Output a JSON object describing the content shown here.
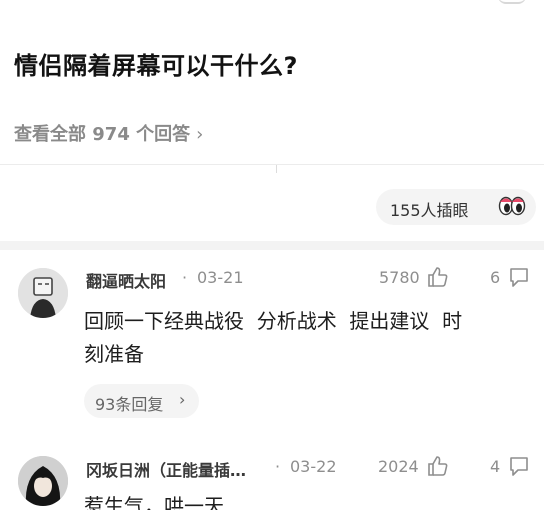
{
  "question": {
    "title": "情侣隔着屏幕可以干什么?",
    "view_all_label": "查看全部 974 个回答",
    "chevron": "›"
  },
  "reactions": {
    "count_label": "155人插眼",
    "emoji_icon": "eyes-icon"
  },
  "answers": [
    {
      "author": "翻逼晒太阳",
      "date_sep": "·",
      "date": "03-21",
      "likes": "5780",
      "comments": "6",
      "text_line1": "回顾一下经典战役  分析战术  提出建议  时",
      "text_line2": "刻准备",
      "replies_label": "93条回复",
      "replies_chevron": "›"
    },
    {
      "author": "冈坂日洲（正能量插…",
      "date_sep": "·",
      "date": "03-22",
      "likes": "2024",
      "comments": "4",
      "text_line1": "惹生气，哄一天"
    }
  ],
  "colors": {
    "title": "#121212",
    "muted": "#8e8e8e",
    "pill_bg": "#f4f4f4",
    "section_gap": "#f3f3f3"
  }
}
